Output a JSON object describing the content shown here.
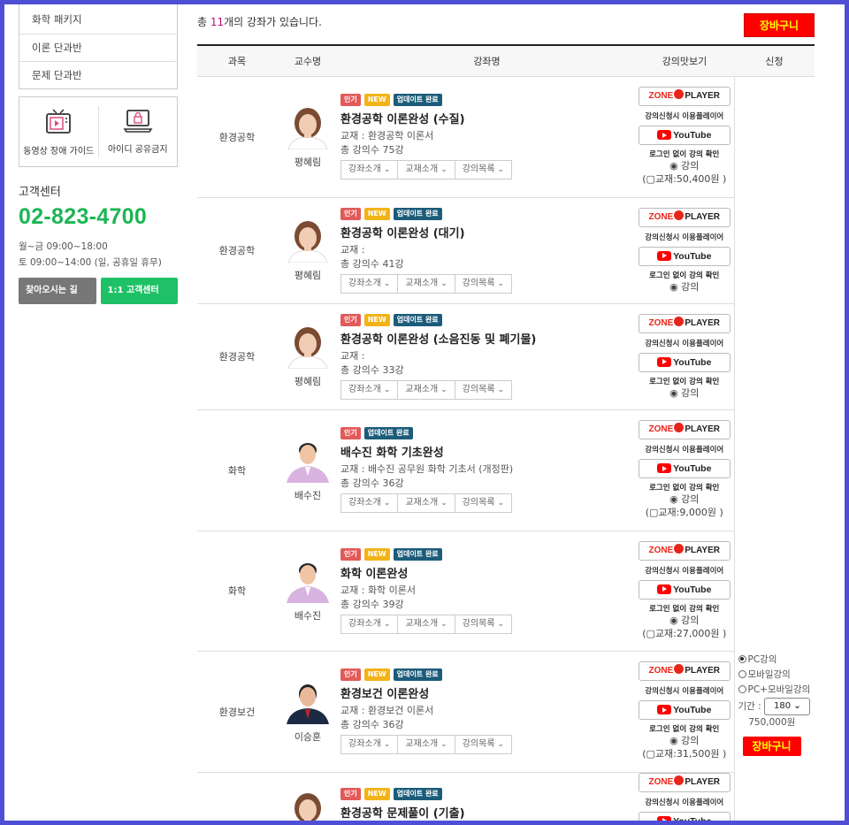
{
  "sidebar": {
    "menu": [
      "화학 패키지",
      "이론 단과반",
      "문제 단과반"
    ],
    "icons": [
      {
        "label": "동영상 장애 가이드",
        "icon": "tv-play-icon"
      },
      {
        "label": "아이디 공유금지",
        "icon": "laptop-lock-icon"
      }
    ],
    "cs_title": "고객센터",
    "cs_phone": "02-823-4700",
    "cs_hours_1": "월~금 09:00~18:00",
    "cs_hours_2": "토 09:00~14:00 (일, 공휴일 휴무)",
    "btn_directions": "찾아오시는 길",
    "btn_support": "1:1 고객센터"
  },
  "main": {
    "total_prefix": "총 ",
    "total_count": "11",
    "total_suffix": "개의 강좌가 있습니다.",
    "cart_label": "장바구니",
    "headers": [
      "과목",
      "교수명",
      "강좌명",
      "강의맛보기",
      "신청"
    ]
  },
  "labels": {
    "badge_hot": "인기",
    "badge_new": "NEW",
    "badge_update": "업데이트 완료",
    "sel_course": "강좌소개",
    "sel_book": "교재소개",
    "sel_list": "강의목록",
    "zone_1": "ZONE",
    "zone_2": "PLAYER",
    "zone_note": "강의신청시 이용플레이어",
    "youtube": "YouTube",
    "login_note": "로그인 없이 강의 확인",
    "lecture_radio": "◉ 강의"
  },
  "courses": [
    {
      "subject": "환경공학",
      "professor": "평혜림",
      "new": true,
      "title": "환경공학 이론완성 (수질)",
      "book": "교재 : 환경공학 이론서",
      "count": "총 강의수 75강",
      "book_price": "(▢교재:50,400원 )"
    },
    {
      "subject": "환경공학",
      "professor": "평혜림",
      "new": true,
      "title": "환경공학 이론완성 (대기)",
      "book": "교재 :",
      "count": "총 강의수 41강",
      "book_price": ""
    },
    {
      "subject": "환경공학",
      "professor": "평혜림",
      "new": true,
      "title": "환경공학 이론완성 (소음진동 및 폐기물)",
      "book": "교재 :",
      "count": "총 강의수 33강",
      "book_price": ""
    },
    {
      "subject": "화학",
      "professor": "배수진",
      "new": false,
      "title": "배수진 화학 기초완성",
      "book": "교재 : 배수진 공무원 화학 기초서 (개정판)",
      "count": "총 강의수 36강",
      "book_price": "(▢교재:9,000원 )"
    },
    {
      "subject": "화학",
      "professor": "배수진",
      "new": true,
      "title": "화학 이론완성",
      "book": "교재 : 화학 이론서",
      "count": "총 강의수 39강",
      "book_price": "(▢교재:27,000원 )"
    },
    {
      "subject": "환경보건",
      "professor": "이승훈",
      "new": true,
      "title": "환경보건 이론완성",
      "book": "교재 : 환경보건 이론서",
      "count": "총 강의수 36강",
      "book_price": "(▢교재:31,500원 )"
    },
    {
      "subject": "",
      "professor": "",
      "new": true,
      "title": "환경공학 문제풀이 (기출)",
      "book": "",
      "count": "",
      "book_price": ""
    }
  ],
  "apply": {
    "opt_pc": "PC강의",
    "opt_mobile": "모바일강의",
    "opt_both": "PC+모바일강의",
    "period_label": "기간 :",
    "period_value": "180",
    "price": "750,000원",
    "cart_label": "장바구니"
  },
  "colors": {
    "phone": "#1bb653",
    "cart_bg": "#ff0000",
    "cart_text": "#ffff00",
    "count": "#c0107a",
    "frame": "#4f4fd6"
  }
}
